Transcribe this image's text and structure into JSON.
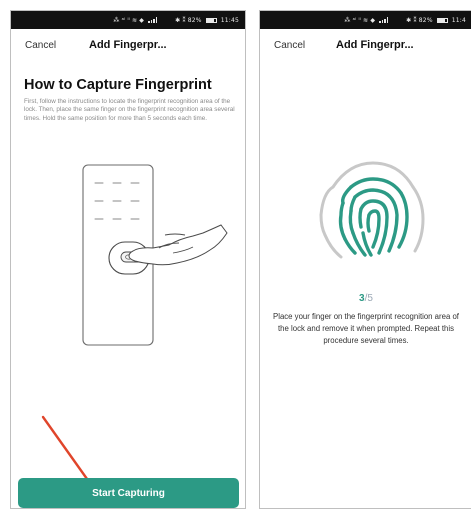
{
  "colors": {
    "accent": "#2c9a85",
    "arrow": "#e0452b",
    "statusbar": "#111111"
  },
  "left_screen": {
    "status_bar": {
      "left_icons": "⁂ ᵃˡ ˡˡ ≋ ◆",
      "right_text": "✱ ⁑ 82%",
      "time": "11:45"
    },
    "nav": {
      "cancel_label": "Cancel",
      "title": "Add Fingerpr..."
    },
    "heading": "How to Capture Fingerprint",
    "instructions": "First, follow the instructions to locate the fingerprint recognition area of the lock. Then, place the same finger on the fingerprint recognition area several times. Hold the same position for more than 5 seconds each time.",
    "start_button_label": "Start Capturing",
    "illustration_icon": "lock-with-finger-icon",
    "pointer_icon": "red-arrow-icon"
  },
  "right_screen": {
    "status_bar": {
      "left_icons": "⁂ ᵃˡ ˡˡ ≋ ◆",
      "right_text": "✱ ⁑ 82%",
      "time": "11:4"
    },
    "nav": {
      "cancel_label": "Cancel",
      "title": "Add Fingerpr..."
    },
    "fingerprint_icon": "fingerprint-icon",
    "progress": {
      "current": "3",
      "separator": "/",
      "total": "5"
    },
    "instruction": "Place your finger on the fingerprint recognition area of the lock and remove it when prompted. Repeat this procedure several times."
  }
}
